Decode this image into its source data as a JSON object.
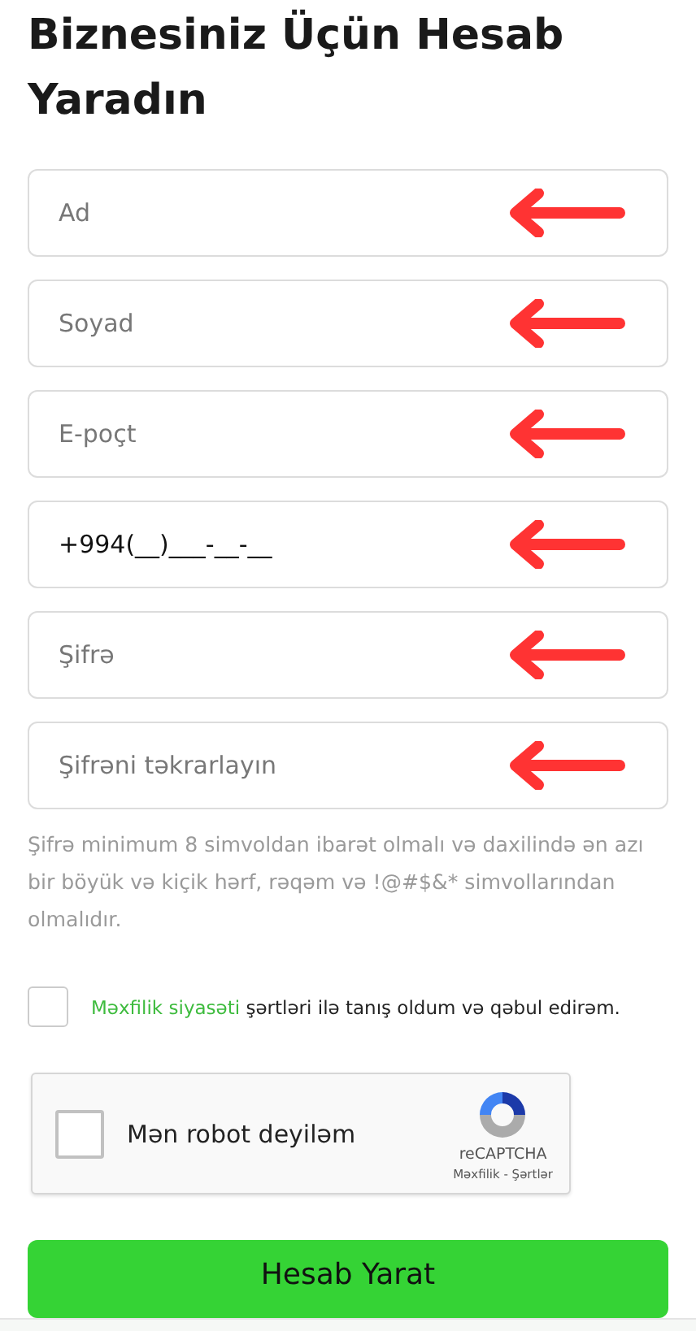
{
  "title": "Biznesiniz Üçün Hesab Yaradın",
  "fields": [
    {
      "placeholder": "Ad",
      "marked": true
    },
    {
      "placeholder": "Soyad",
      "marked": true
    },
    {
      "placeholder": "E-poçt",
      "marked": true
    },
    {
      "value": "+994(__)___-__-__",
      "marked": true
    },
    {
      "placeholder": "Şifrə",
      "marked": true
    },
    {
      "placeholder": "Şifrəni təkrarlayın",
      "marked": true
    }
  ],
  "password_hint": "Şifrə minimum 8 simvoldan ibarət olmalı və daxilində ən azı bir böyük və kiçik hərf, rəqəm və !@#$&* simvollarından olmalıdır.",
  "consent": {
    "checked": false,
    "link": "Məxfilik siyasəti",
    "text": "şərtləri ilə tanış oldum və qəbul edirəm."
  },
  "captcha": {
    "checked": false,
    "label": "Mən robot deyiləm",
    "brand": "reCAPTCHA",
    "links": "Məxfilik - Şərtlər"
  },
  "submit": "Hesab Yarat"
}
